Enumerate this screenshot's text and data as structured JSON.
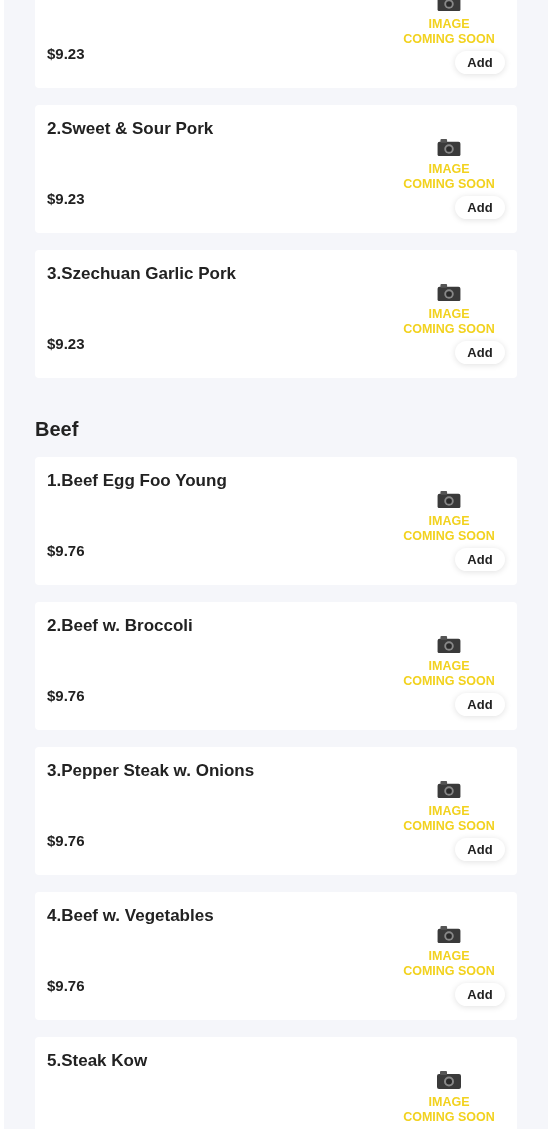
{
  "sections": [
    {
      "items": [
        {
          "price": "$9.23",
          "image_text": [
            "IMAGE",
            "COMING SOON"
          ],
          "add": "Add"
        },
        {
          "name": "2.Sweet & Sour Pork",
          "price": "$9.23",
          "image_text": [
            "IMAGE",
            "COMING SOON"
          ],
          "add": "Add"
        },
        {
          "name": "3.Szechuan Garlic Pork",
          "price": "$9.23",
          "image_text": [
            "IMAGE",
            "COMING SOON"
          ],
          "add": "Add"
        }
      ]
    },
    {
      "title": "Beef",
      "items": [
        {
          "name": "1.Beef Egg Foo Young",
          "price": "$9.76",
          "image_text": [
            "IMAGE",
            "COMING SOON"
          ],
          "add": "Add"
        },
        {
          "name": "2.Beef w. Broccoli",
          "price": "$9.76",
          "image_text": [
            "IMAGE",
            "COMING SOON"
          ],
          "add": "Add"
        },
        {
          "name": "3.Pepper Steak w. Onions",
          "price": "$9.76",
          "image_text": [
            "IMAGE",
            "COMING SOON"
          ],
          "add": "Add"
        },
        {
          "name": "4.Beef w. Vegetables",
          "price": "$9.76",
          "image_text": [
            "IMAGE",
            "COMING SOON"
          ],
          "add": "Add"
        },
        {
          "name": "5.Steak Kow",
          "image_text": [
            "IMAGE",
            "COMING SOON"
          ]
        }
      ]
    }
  ]
}
